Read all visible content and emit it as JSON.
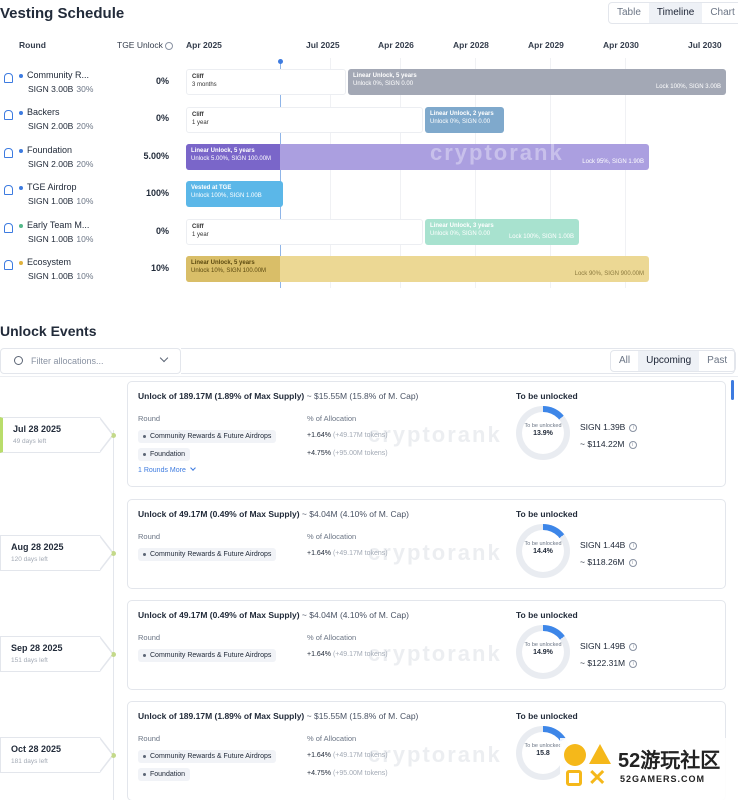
{
  "vesting": {
    "title": "Vesting Schedule",
    "views": [
      "Table",
      "Timeline",
      "Chart"
    ],
    "active_view": "Timeline",
    "headers": {
      "round": "Round",
      "tge": "TGE Unlock",
      "timeline": [
        "Apr 2025",
        "Jul 2025",
        "Apr 2026",
        "Apr 2028",
        "Apr 2029",
        "Apr 2030",
        "Jul 2030"
      ]
    },
    "rows": [
      {
        "name": "Community R...",
        "amount": "SIGN 3.00B",
        "share": "30%",
        "tge": "0%",
        "dot": "#3d7be0"
      },
      {
        "name": "Backers",
        "amount": "SIGN 2.00B",
        "share": "20%",
        "tge": "0%",
        "dot": "#3d7be0"
      },
      {
        "name": "Foundation",
        "amount": "SIGN 2.00B",
        "share": "20%",
        "tge": "5.00%",
        "dot": "#3d7be0"
      },
      {
        "name": "TGE Airdrop",
        "amount": "SIGN 1.00B",
        "share": "10%",
        "tge": "100%",
        "dot": "#3d7be0"
      },
      {
        "name": "Early Team M...",
        "amount": "SIGN 1.00B",
        "share": "10%",
        "tge": "0%",
        "dot": "#52b788"
      },
      {
        "name": "Ecosystem",
        "amount": "SIGN 1.00B",
        "share": "10%",
        "tge": "10%",
        "dot": "#e0b23d"
      }
    ],
    "bars": {
      "r1_cliff": {
        "t": "Cliff",
        "s": "3 months"
      },
      "r1_main": {
        "t": "Linear Unlock, 5 years",
        "s": "Unlock 0%, SIGN 0.00",
        "r": "Lock 100%, SIGN 3.00B",
        "color": "#a3a8b5"
      },
      "r2_cliff": {
        "t": "Cliff",
        "s": "1 year"
      },
      "r2_main": {
        "t": "Linear Unlock, 2 years",
        "s": "Unlock 0%, SIGN 0.00",
        "color": "#7fa9cc"
      },
      "r3_unlocked": {
        "t": "Linear Unlock, 5 years",
        "s": "Unlock 5.00%, SIGN 100.00M",
        "color": "#7a66c9"
      },
      "r3_locked": {
        "r": "Lock 95%, SIGN 1.90B",
        "color": "#ab9fe0"
      },
      "r4_main": {
        "t": "Vested at TGE",
        "s": "Unlock 100%, SIGN 1.00B",
        "color": "#5bb7e8"
      },
      "r5_cliff": {
        "t": "Cliff",
        "s": "1 year"
      },
      "r5_main": {
        "t": "Linear Unlock, 3 years",
        "s": "Unlock 0%, SIGN 0.00",
        "r": "Lock 100%, SIGN 1.00B",
        "color": "#a8e2cf"
      },
      "r6_unlocked": {
        "t": "Linear Unlock, 5 years",
        "s": "Unlock 10%, SIGN 100.00M",
        "color": "#d9be68"
      },
      "r6_locked": {
        "r": "Lock 90%, SIGN 900.00M",
        "color": "#ecd894"
      }
    }
  },
  "events": {
    "title": "Unlock Events",
    "filter_placeholder": "Filter allocations...",
    "tabs": [
      "All",
      "Upcoming",
      "Past"
    ],
    "active_tab": "Upcoming",
    "labels": {
      "round": "Round",
      "alloc": "% of Allocation",
      "tbu": "To be unlocked",
      "donut": "To be unlocked",
      "more": "1 Rounds More"
    },
    "items": [
      {
        "date": "Jul 28 2025",
        "left": "49 days left",
        "head": "Unlock of 189.17M (1.89% of Max Supply)",
        "usd": "~ $15.55M (15.8% of M. Cap)",
        "rounds": [
          {
            "n": "Community Rewards & Future Airdrops",
            "p": "+1.64%",
            "t": "(+49.17M tokens)"
          },
          {
            "n": "Foundation",
            "p": "+4.75%",
            "t": "(+95.00M tokens)"
          }
        ],
        "pct": "13.9%",
        "fill": 13.9,
        "sign": "SIGN 1.39B",
        "val": "~ $114.22M",
        "more": true
      },
      {
        "date": "Aug 28 2025",
        "left": "120 days left",
        "head": "Unlock of 49.17M (0.49% of Max Supply)",
        "usd": "~ $4.04M (4.10% of M. Cap)",
        "rounds": [
          {
            "n": "Community Rewards & Future Airdrops",
            "p": "+1.64%",
            "t": "(+49.17M tokens)"
          }
        ],
        "pct": "14.4%",
        "fill": 14.4,
        "sign": "SIGN 1.44B",
        "val": "~ $118.26M"
      },
      {
        "date": "Sep 28 2025",
        "left": "151 days left",
        "head": "Unlock of 49.17M (0.49% of Max Supply)",
        "usd": "~ $4.04M (4.10% of M. Cap)",
        "rounds": [
          {
            "n": "Community Rewards & Future Airdrops",
            "p": "+1.64%",
            "t": "(+49.17M tokens)"
          }
        ],
        "pct": "14.9%",
        "fill": 14.9,
        "sign": "SIGN 1.49B",
        "val": "~ $122.31M"
      },
      {
        "date": "Oct 28 2025",
        "left": "181 days left",
        "head": "Unlock of 189.17M (1.89% of Max Supply)",
        "usd": "~ $15.55M (15.8% of M. Cap)",
        "rounds": [
          {
            "n": "Community Rewards & Future Airdrops",
            "p": "+1.64%",
            "t": "(+49.17M tokens)"
          },
          {
            "n": "Foundation",
            "p": "+4.75%",
            "t": "(+95.00M tokens)"
          }
        ],
        "pct": "15.8",
        "fill": 15.8,
        "sign": "",
        "val": ""
      }
    ]
  },
  "watermark": "cryptorank",
  "site": {
    "name": "52游玩社区",
    "url": "52GAMERS.COM"
  }
}
